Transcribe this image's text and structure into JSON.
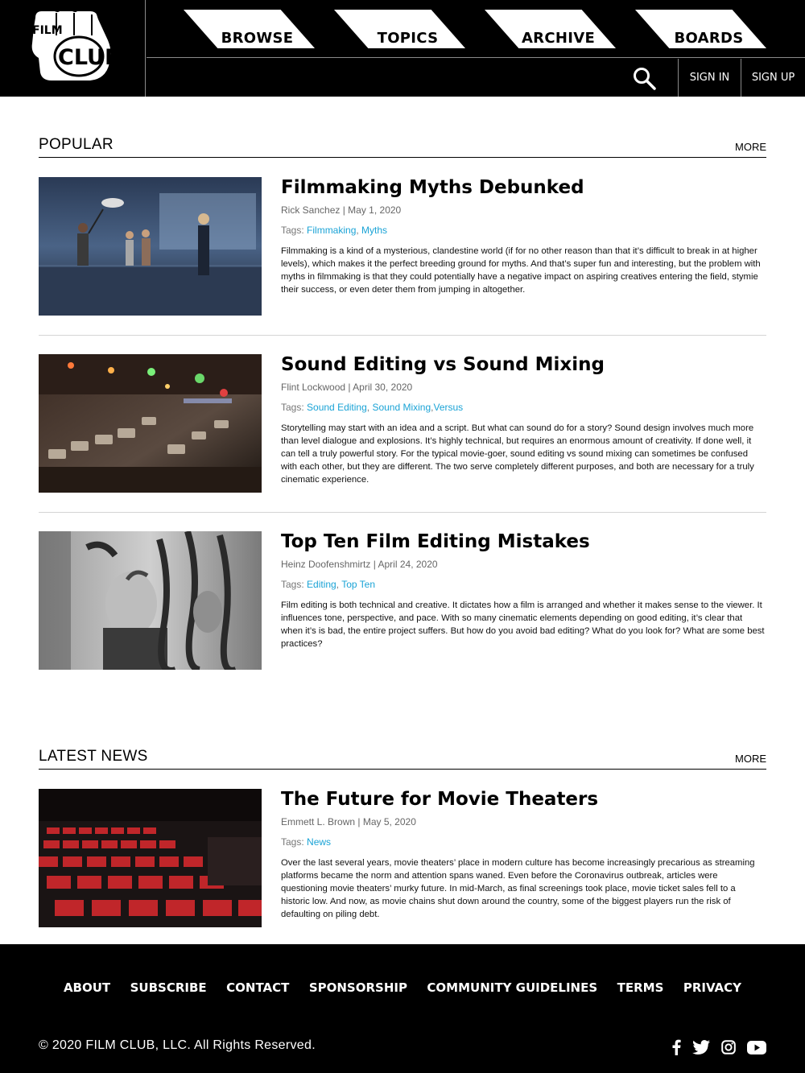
{
  "brand": {
    "logo_line1": "FILM",
    "logo_line2": "CLUB"
  },
  "nav": {
    "tabs": [
      {
        "label": "BROWSE"
      },
      {
        "label": "TOPICS"
      },
      {
        "label": "ARCHIVE"
      },
      {
        "label": "BOARDS"
      }
    ],
    "search_icon": "search-icon",
    "sign_in": "SIGN IN",
    "sign_up": "SIGN UP"
  },
  "popular": {
    "title": "POPULAR",
    "more": "MORE",
    "articles": [
      {
        "title": "Filmmaking Myths Debunked",
        "author": "Rick Sanchez",
        "date": "May 1, 2020",
        "tags_label": "Tags:",
        "tags": [
          "Filmmaking",
          "Myths"
        ],
        "excerpt": "Filmmaking is a kind of a mysterious, clandestine world (if for no other reason than that it’s difficult to break in at higher levels), which makes it the perfect breeding ground for myths. And that’s super fun and interesting, but the problem with myths in filmmaking is that they could potentially have a negative impact on aspiring creatives entering the field, stymie their success, or even deter them from jumping in altogether."
      },
      {
        "title": "Sound Editing vs Sound Mixing",
        "author": "Flint Lockwood",
        "date": "April 30, 2020",
        "tags_label": "Tags:",
        "tags": [
          "Sound Editing",
          "Sound Mixing",
          "Versus"
        ],
        "excerpt": "Storytelling may start with an idea and a script. But what can sound do for a story? Sound design involves much more than level dialogue and explosions. It’s highly technical, but requires an enormous amount of creativity. If done well, it can tell a truly powerful story. For the typical movie-goer, sound editing vs sound mixing can sometimes be confused with each other, but they are different. The two serve completely different purposes, and both are necessary for a truly cinematic experience."
      },
      {
        "title": "Top Ten Film Editing Mistakes",
        "author": "Heinz Doofenshmirtz",
        "date": "April 24, 2020",
        "tags_label": "Tags:",
        "tags": [
          "Editing",
          "Top Ten"
        ],
        "excerpt": "Film editing is both technical and creative. It dictates how a film is arranged and whether it makes sense to the viewer. It influences tone, perspective, and pace. With so many cinematic elements depending on good editing, it’s clear that when it’s is bad, the entire project suffers. But how do you avoid bad editing? What do you look for? What are some best practices?"
      }
    ]
  },
  "latest": {
    "title": "LATEST NEWS",
    "more": "MORE",
    "articles": [
      {
        "title": "The Future for Movie Theaters",
        "author": "Emmett L. Brown",
        "date": "May 5, 2020",
        "tags_label": "Tags:",
        "tags": [
          "News"
        ],
        "excerpt": "Over the last several years, movie theaters’ place in modern culture has become increasingly precarious as streaming platforms became the norm and attention spans waned. Even before the Coronavirus outbreak, articles were questioning movie theaters’ murky future. In mid-March, as final screenings took place, movie ticket sales fell to a historic low. And now, as movie chains shut down around the country, some of the biggest players run the risk of defaulting on piling debt."
      }
    ]
  },
  "footer": {
    "links": [
      "ABOUT",
      "SUBSCRIBE",
      "CONTACT",
      "SPONSORSHIP",
      "COMMUNITY GUIDELINES",
      "TERMS",
      "PRIVACY"
    ],
    "copyright": "© 2020 FILM CLUB, LLC. All Rights Reserved.",
    "social_icons": [
      "facebook-icon",
      "twitter-icon",
      "instagram-icon",
      "youtube-icon"
    ]
  },
  "colors": {
    "tag_link": "#1aa3d6",
    "header_bg": "#000000",
    "divider": "#d4d4d4"
  }
}
